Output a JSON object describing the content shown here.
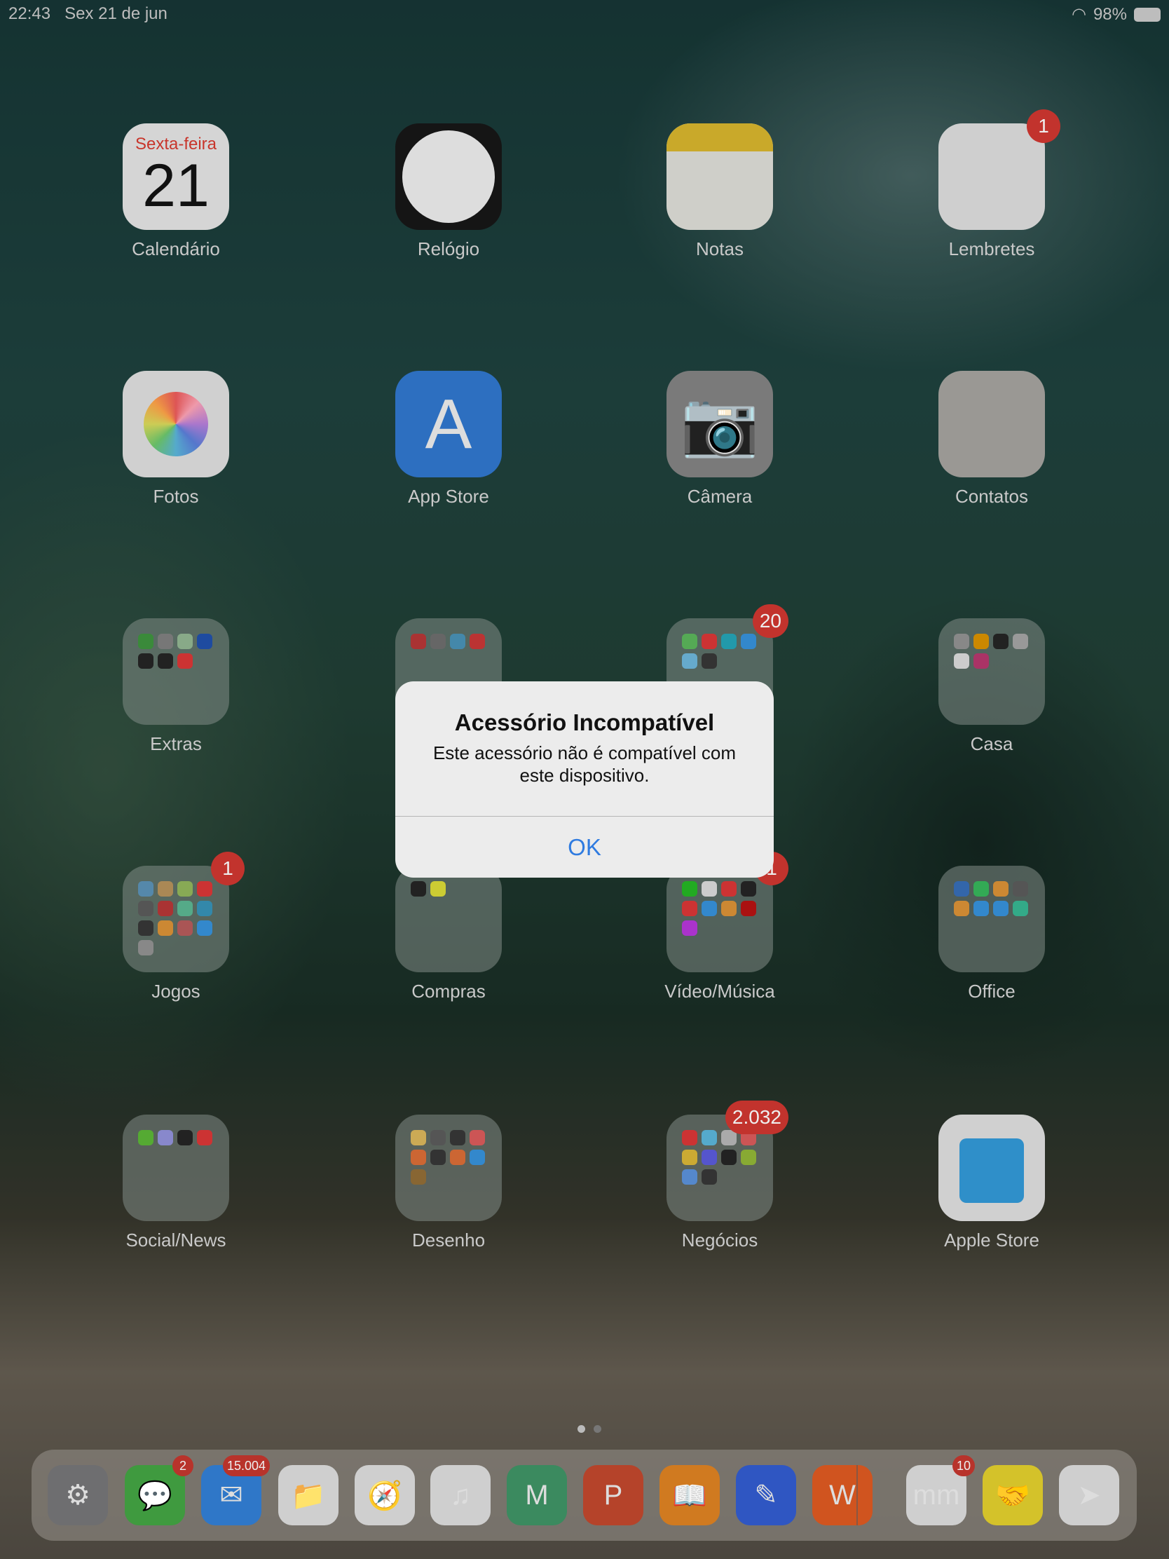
{
  "status_bar": {
    "time": "22:43",
    "date": "Sex 21 de jun",
    "battery": "98%"
  },
  "apps": [
    {
      "label": "Calendário",
      "icon": "calendar-icon",
      "day_name": "Sexta-feira",
      "day": "21",
      "bg": "#d5d5d5"
    },
    {
      "label": "Relógio",
      "icon": "clock-icon",
      "bg": "#151515"
    },
    {
      "label": "Notas",
      "icon": "notes-icon",
      "bg": "#cfcfc9"
    },
    {
      "label": "Lembretes",
      "icon": "reminders-icon",
      "bg": "#cfcfcf",
      "badge": "1"
    },
    {
      "label": "Fotos",
      "icon": "photos-icon",
      "bg": "#d0d0d0"
    },
    {
      "label": "App Store",
      "icon": "app-store-icon",
      "bg": "#2d6fc0"
    },
    {
      "label": "Câmera",
      "icon": "camera-icon",
      "bg": "#7a7a7a"
    },
    {
      "label": "Contatos",
      "icon": "contacts-icon",
      "bg": "#9a9894"
    },
    {
      "label": "Extras",
      "folder": [
        "#3a8a3a",
        "#777",
        "#8a8",
        "#1e4ba0",
        "#222",
        "#222",
        "#c33"
      ]
    },
    {
      "label": "",
      "folder": [
        "#a33",
        "#666",
        "#48a",
        "#b33"
      ]
    },
    {
      "label": "",
      "folder": [
        "#5a5",
        "#c33",
        "#29a",
        "#38c",
        "#6ac",
        "#333"
      ],
      "badge": "20"
    },
    {
      "label": "Casa",
      "folder": [
        "#888",
        "#c80",
        "#222",
        "#999",
        "#ccc",
        "#a36"
      ]
    },
    {
      "label": "Jogos",
      "folder": [
        "#58a",
        "#a85",
        "#8a5",
        "#c33",
        "#555",
        "#a33",
        "#5a8",
        "#38a",
        "#333",
        "#c83",
        "#a55",
        "#38c",
        "#888"
      ],
      "badge": "1"
    },
    {
      "label": "Compras",
      "folder": [
        "#222",
        "#cc3"
      ]
    },
    {
      "label": "Vídeo/Música",
      "folder": [
        "#2a2",
        "#ccc",
        "#c33",
        "#222",
        "#c33",
        "#38c",
        "#c83",
        "#a11",
        "#a3c"
      ],
      "badge": "1"
    },
    {
      "label": "Office",
      "folder": [
        "#36a",
        "#3a5",
        "#c83",
        "#555",
        "#c83",
        "#38c",
        "#38c",
        "#3a8"
      ]
    },
    {
      "label": "Social/News",
      "folder": [
        "#5a3",
        "#88c",
        "#222",
        "#c33"
      ]
    },
    {
      "label": "Desenho",
      "folder": [
        "#ca5",
        "#555",
        "#333",
        "#c55",
        "#c63",
        "#333",
        "#c63",
        "#38c",
        "#863"
      ]
    },
    {
      "label": "Negócios",
      "folder": [
        "#c33",
        "#5ac",
        "#aaa",
        "#c55",
        "#ca3",
        "#55c",
        "#222",
        "#8a3",
        "#58c",
        "#333"
      ],
      "badge": "2.032"
    },
    {
      "label": "Apple Store",
      "icon": "apple-store-bag-icon",
      "bg": "#d0d0d0"
    }
  ],
  "dock": [
    {
      "name": "settings",
      "bg": "#6e6e70",
      "glyph": "⚙"
    },
    {
      "name": "messages",
      "bg": "#3f9a3f",
      "glyph": "💬",
      "badge": "2"
    },
    {
      "name": "mail",
      "bg": "#2f77c8",
      "glyph": "✉",
      "badge": "15.004"
    },
    {
      "name": "files",
      "bg": "#cfcfcf",
      "glyph": "📁"
    },
    {
      "name": "safari",
      "bg": "#cfcfcf",
      "glyph": "🧭"
    },
    {
      "name": "music",
      "bg": "#cfcfcf",
      "glyph": "♫"
    },
    {
      "name": "mi-home",
      "bg": "#3b8a5f",
      "glyph": "M"
    },
    {
      "name": "powerpoint",
      "bg": "#b5432a",
      "glyph": "P"
    },
    {
      "name": "books",
      "bg": "#d07a20",
      "glyph": "📖"
    },
    {
      "name": "notability",
      "bg": "#2f56c2",
      "glyph": "✎"
    },
    {
      "name": "wattpad",
      "bg": "#d0541f",
      "glyph": "W"
    },
    {
      "name": "mm",
      "bg": "#cfcfcf",
      "glyph": "mm",
      "badge": "10"
    },
    {
      "name": "mercado-livre",
      "bg": "#d4c22a",
      "glyph": "🤝"
    },
    {
      "name": "maps",
      "bg": "#cfcfcf",
      "glyph": "➤"
    }
  ],
  "alert": {
    "title": "Acessório Incompatível",
    "message": "Este acessório não é compatível com este dispositivo.",
    "ok": "OK"
  }
}
